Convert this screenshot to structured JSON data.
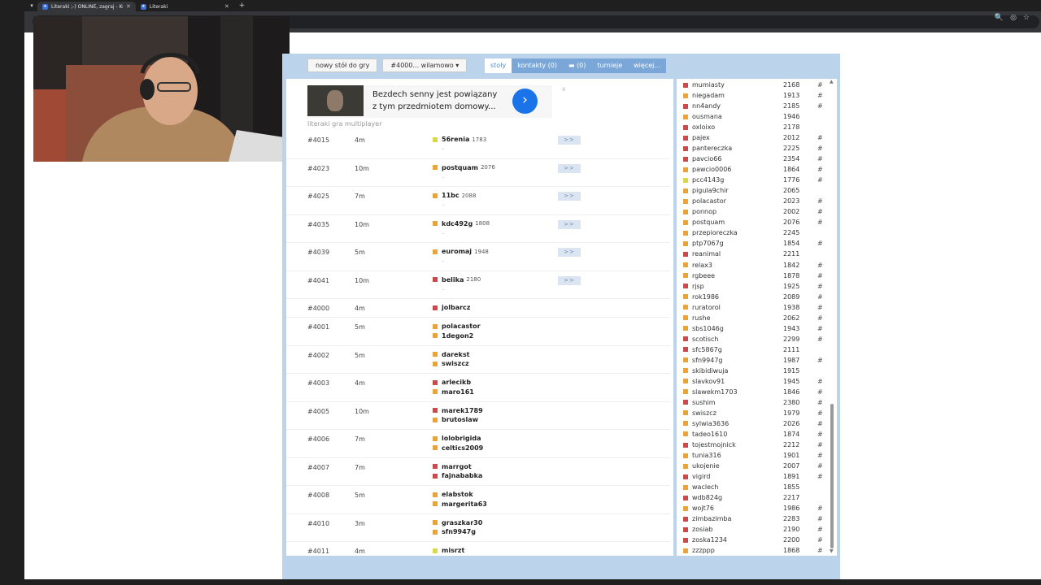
{
  "browser": {
    "tabs": [
      {
        "title": "Literaki ;-) ONLINE, zagraj - Ku...",
        "active": true
      },
      {
        "title": "Literaki",
        "active": false
      }
    ],
    "new_tab": "+",
    "tab_close": "✕",
    "tab_menu": "▾",
    "url_icons": [
      "🔍",
      "◎",
      "☆"
    ]
  },
  "toolbar": {
    "new_table": "nowy stół do gry",
    "table_select": "#4000... wilamowo ▾"
  },
  "nav": {
    "tables": "stoły",
    "contacts": "kontakty (0)",
    "messages": "(0)",
    "tournaments": "turnieje",
    "more": "więcej..."
  },
  "ad": {
    "line1": "Bezdech senny jest powiązany",
    "line2": "z tym przedmiotem domowy...",
    "go": "›",
    "close": "x"
  },
  "caption": "literaki gra multiplayer",
  "colors": {
    "orange": "#e8a33a",
    "red": "#c94a4a",
    "yellow": "#d8d84a",
    "frame": "#bcd3ec",
    "nav": "#7aa7d8"
  },
  "tables": [
    {
      "id": "#4015",
      "time": "4m",
      "players": [
        {
          "name": "56renia",
          "rating": "1783",
          "color": "yellow"
        }
      ],
      "waiting": true,
      "join": ">>"
    },
    {
      "id": "#4023",
      "time": "10m",
      "players": [
        {
          "name": "postquam",
          "rating": "2076",
          "color": "orange"
        }
      ],
      "waiting": true,
      "join": ">>"
    },
    {
      "id": "#4025",
      "time": "7m",
      "players": [
        {
          "name": "11bc",
          "rating": "2088",
          "color": "orange"
        }
      ],
      "waiting": true,
      "join": ">>"
    },
    {
      "id": "#4035",
      "time": "10m",
      "players": [
        {
          "name": "kdc492g",
          "rating": "1808",
          "color": "orange"
        }
      ],
      "waiting": true,
      "join": ">>"
    },
    {
      "id": "#4039",
      "time": "5m",
      "players": [
        {
          "name": "euromaj",
          "rating": "1948",
          "color": "orange"
        }
      ],
      "waiting": true,
      "join": ">>"
    },
    {
      "id": "#4041",
      "time": "10m",
      "players": [
        {
          "name": "belika",
          "rating": "2180",
          "color": "red"
        }
      ],
      "waiting": true,
      "join": ">>"
    },
    {
      "id": "#4000",
      "time": "4m",
      "players": [
        {
          "name": "jolbarcz",
          "rating": "",
          "color": "red"
        }
      ]
    },
    {
      "id": "#4001",
      "time": "5m",
      "players": [
        {
          "name": "polacastor",
          "rating": "",
          "color": "orange"
        },
        {
          "name": "1degon2",
          "rating": "",
          "color": "orange"
        }
      ]
    },
    {
      "id": "#4002",
      "time": "5m",
      "players": [
        {
          "name": "darekst",
          "rating": "",
          "color": "orange"
        },
        {
          "name": "swiszcz",
          "rating": "",
          "color": "orange"
        }
      ]
    },
    {
      "id": "#4003",
      "time": "4m",
      "players": [
        {
          "name": "arlecikb",
          "rating": "",
          "color": "red"
        },
        {
          "name": "maro161",
          "rating": "",
          "color": "orange"
        }
      ]
    },
    {
      "id": "#4005",
      "time": "10m",
      "players": [
        {
          "name": "marek1789",
          "rating": "",
          "color": "red"
        },
        {
          "name": "brutoslaw",
          "rating": "",
          "color": "orange"
        }
      ]
    },
    {
      "id": "#4006",
      "time": "7m",
      "players": [
        {
          "name": "lolobrigida",
          "rating": "",
          "color": "orange"
        },
        {
          "name": "celtics2009",
          "rating": "",
          "color": "orange"
        }
      ]
    },
    {
      "id": "#4007",
      "time": "7m",
      "players": [
        {
          "name": "marrgot",
          "rating": "",
          "color": "red"
        },
        {
          "name": "fajnababka",
          "rating": "",
          "color": "red"
        }
      ]
    },
    {
      "id": "#4008",
      "time": "5m",
      "players": [
        {
          "name": "elabstok",
          "rating": "",
          "color": "orange"
        },
        {
          "name": "margerita63",
          "rating": "",
          "color": "orange"
        }
      ]
    },
    {
      "id": "#4010",
      "time": "3m",
      "players": [
        {
          "name": "graszkar30",
          "rating": "",
          "color": "orange"
        },
        {
          "name": "sfn9947g",
          "rating": "",
          "color": "orange"
        }
      ]
    },
    {
      "id": "#4011",
      "time": "4m",
      "players": [
        {
          "name": "misrzt",
          "rating": "",
          "color": "yellow"
        }
      ]
    }
  ],
  "players": [
    {
      "name": "mumiasty",
      "rating": "2168",
      "hash": "#",
      "color": "red"
    },
    {
      "name": "niegadam",
      "rating": "1913",
      "hash": "#",
      "color": "orange"
    },
    {
      "name": "nn4andy",
      "rating": "2185",
      "hash": "#",
      "color": "red"
    },
    {
      "name": "ousmana",
      "rating": "1946",
      "hash": "",
      "color": "orange"
    },
    {
      "name": "oxloixo",
      "rating": "2178",
      "hash": "",
      "color": "red"
    },
    {
      "name": "pajex",
      "rating": "2012",
      "hash": "#",
      "color": "red"
    },
    {
      "name": "pantereczka",
      "rating": "2225",
      "hash": "#",
      "color": "red"
    },
    {
      "name": "pavcio66",
      "rating": "2354",
      "hash": "#",
      "color": "red"
    },
    {
      "name": "pawcio0006",
      "rating": "1864",
      "hash": "#",
      "color": "orange"
    },
    {
      "name": "pcc4143g",
      "rating": "1776",
      "hash": "#",
      "color": "yellow"
    },
    {
      "name": "pigula9chir",
      "rating": "2065",
      "hash": "",
      "color": "orange"
    },
    {
      "name": "polacastor",
      "rating": "2023",
      "hash": "#",
      "color": "orange"
    },
    {
      "name": "ponnop",
      "rating": "2002",
      "hash": "#",
      "color": "orange"
    },
    {
      "name": "postquam",
      "rating": "2076",
      "hash": "#",
      "color": "orange"
    },
    {
      "name": "przepioreczka",
      "rating": "2245",
      "hash": "",
      "color": "orange"
    },
    {
      "name": "ptp7067g",
      "rating": "1854",
      "hash": "#",
      "color": "orange"
    },
    {
      "name": "reanimal",
      "rating": "2211",
      "hash": "",
      "color": "red"
    },
    {
      "name": "relax3",
      "rating": "1842",
      "hash": "#",
      "color": "orange"
    },
    {
      "name": "rgbeee",
      "rating": "1878",
      "hash": "#",
      "color": "orange"
    },
    {
      "name": "rjsp",
      "rating": "1925",
      "hash": "#",
      "color": "red"
    },
    {
      "name": "rok1986",
      "rating": "2089",
      "hash": "#",
      "color": "orange"
    },
    {
      "name": "ruratorol",
      "rating": "1938",
      "hash": "#",
      "color": "orange"
    },
    {
      "name": "rushe",
      "rating": "2062",
      "hash": "#",
      "color": "orange"
    },
    {
      "name": "sbs1046g",
      "rating": "1943",
      "hash": "#",
      "color": "orange"
    },
    {
      "name": "scotisch",
      "rating": "2299",
      "hash": "#",
      "color": "red"
    },
    {
      "name": "sfc5867g",
      "rating": "2111",
      "hash": "",
      "color": "red"
    },
    {
      "name": "sfn9947g",
      "rating": "1987",
      "hash": "#",
      "color": "orange"
    },
    {
      "name": "skibidiwuja",
      "rating": "1915",
      "hash": "",
      "color": "orange"
    },
    {
      "name": "slavkov91",
      "rating": "1945",
      "hash": "#",
      "color": "orange"
    },
    {
      "name": "slawekm1703",
      "rating": "1846",
      "hash": "#",
      "color": "orange"
    },
    {
      "name": "sushim",
      "rating": "2380",
      "hash": "#",
      "color": "red"
    },
    {
      "name": "swiszcz",
      "rating": "1979",
      "hash": "#",
      "color": "orange"
    },
    {
      "name": "sylwia3636",
      "rating": "2026",
      "hash": "#",
      "color": "orange"
    },
    {
      "name": "tadeo1610",
      "rating": "1874",
      "hash": "#",
      "color": "orange"
    },
    {
      "name": "tojestmojnick",
      "rating": "2212",
      "hash": "#",
      "color": "red"
    },
    {
      "name": "tunia316",
      "rating": "1901",
      "hash": "#",
      "color": "orange"
    },
    {
      "name": "ukojenie",
      "rating": "2007",
      "hash": "#",
      "color": "orange"
    },
    {
      "name": "vigird",
      "rating": "1891",
      "hash": "#",
      "color": "red"
    },
    {
      "name": "waclech",
      "rating": "1855",
      "hash": "",
      "color": "orange"
    },
    {
      "name": "wdb824g",
      "rating": "2217",
      "hash": "",
      "color": "red"
    },
    {
      "name": "wojt76",
      "rating": "1986",
      "hash": "#",
      "color": "orange"
    },
    {
      "name": "zimbazimba",
      "rating": "2283",
      "hash": "#",
      "color": "red"
    },
    {
      "name": "zosiab",
      "rating": "2190",
      "hash": "#",
      "color": "red"
    },
    {
      "name": "zoska1234",
      "rating": "2200",
      "hash": "#",
      "color": "red"
    },
    {
      "name": "zzzppp",
      "rating": "1868",
      "hash": "#",
      "color": "orange"
    }
  ]
}
